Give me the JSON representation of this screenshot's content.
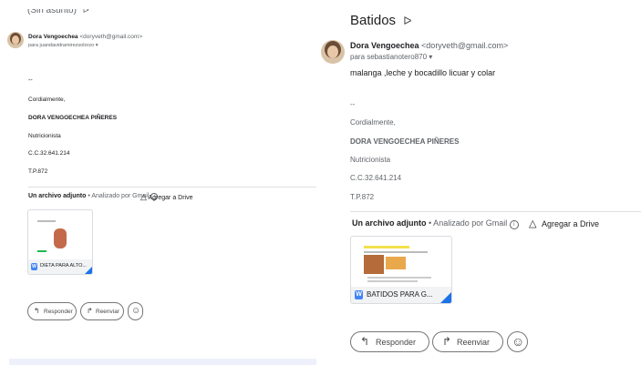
{
  "left": {
    "partial_subject": "(Sin asunto)",
    "sender": {
      "name": "Dora Vengoechea",
      "email": "<doryveth@gmail.com>",
      "to": "para juandavidramirezsolorzo"
    },
    "body_dash": "--",
    "signature": {
      "greeting": "Cordialmente,",
      "name": "DORA VENGOECHEA PIÑERES",
      "role": "Nutricionista",
      "cc": "C.C.32.641.214",
      "tp": "T.P.872"
    },
    "attachments": {
      "title": "Un archivo adjunto",
      "scanned": "• Analizado por Gmail",
      "add_drive": "Agregar a Drive",
      "file_name": "DIETA PARA ALTO..."
    },
    "actions": {
      "reply": "Responder",
      "forward": "Reenviar"
    }
  },
  "right": {
    "subject": "Batidos",
    "sender": {
      "name": "Dora Vengoechea",
      "email": "<doryveth@gmail.com>",
      "to": "para sebastianotero870"
    },
    "body_text": "malanga ,leche y bocadillo licuar y colar",
    "body_dash": "--",
    "signature": {
      "greeting": "Cordialmente,",
      "name": "DORA VENGOECHEA PIÑERES",
      "role": "Nutricionista",
      "cc": "C.C.32.641.214",
      "tp": "T.P.872"
    },
    "attachments": {
      "title": "Un archivo adjunto",
      "scanned": "• Analizado por Gmail",
      "add_drive": "Agregar a Drive",
      "file_name": "BATIDOS PARA G..."
    },
    "actions": {
      "reply": "Responder",
      "forward": "Reenviar"
    }
  },
  "icons": [
    "label-icon",
    "dropdown-icon",
    "info-icon",
    "drive-icon",
    "reply-icon",
    "forward-icon",
    "emoji-icon",
    "word-doc-icon"
  ],
  "colors": {
    "accent": "#1a73e8",
    "doc_blue": "#4285f4",
    "text": "#202124",
    "muted": "#5f6368"
  }
}
